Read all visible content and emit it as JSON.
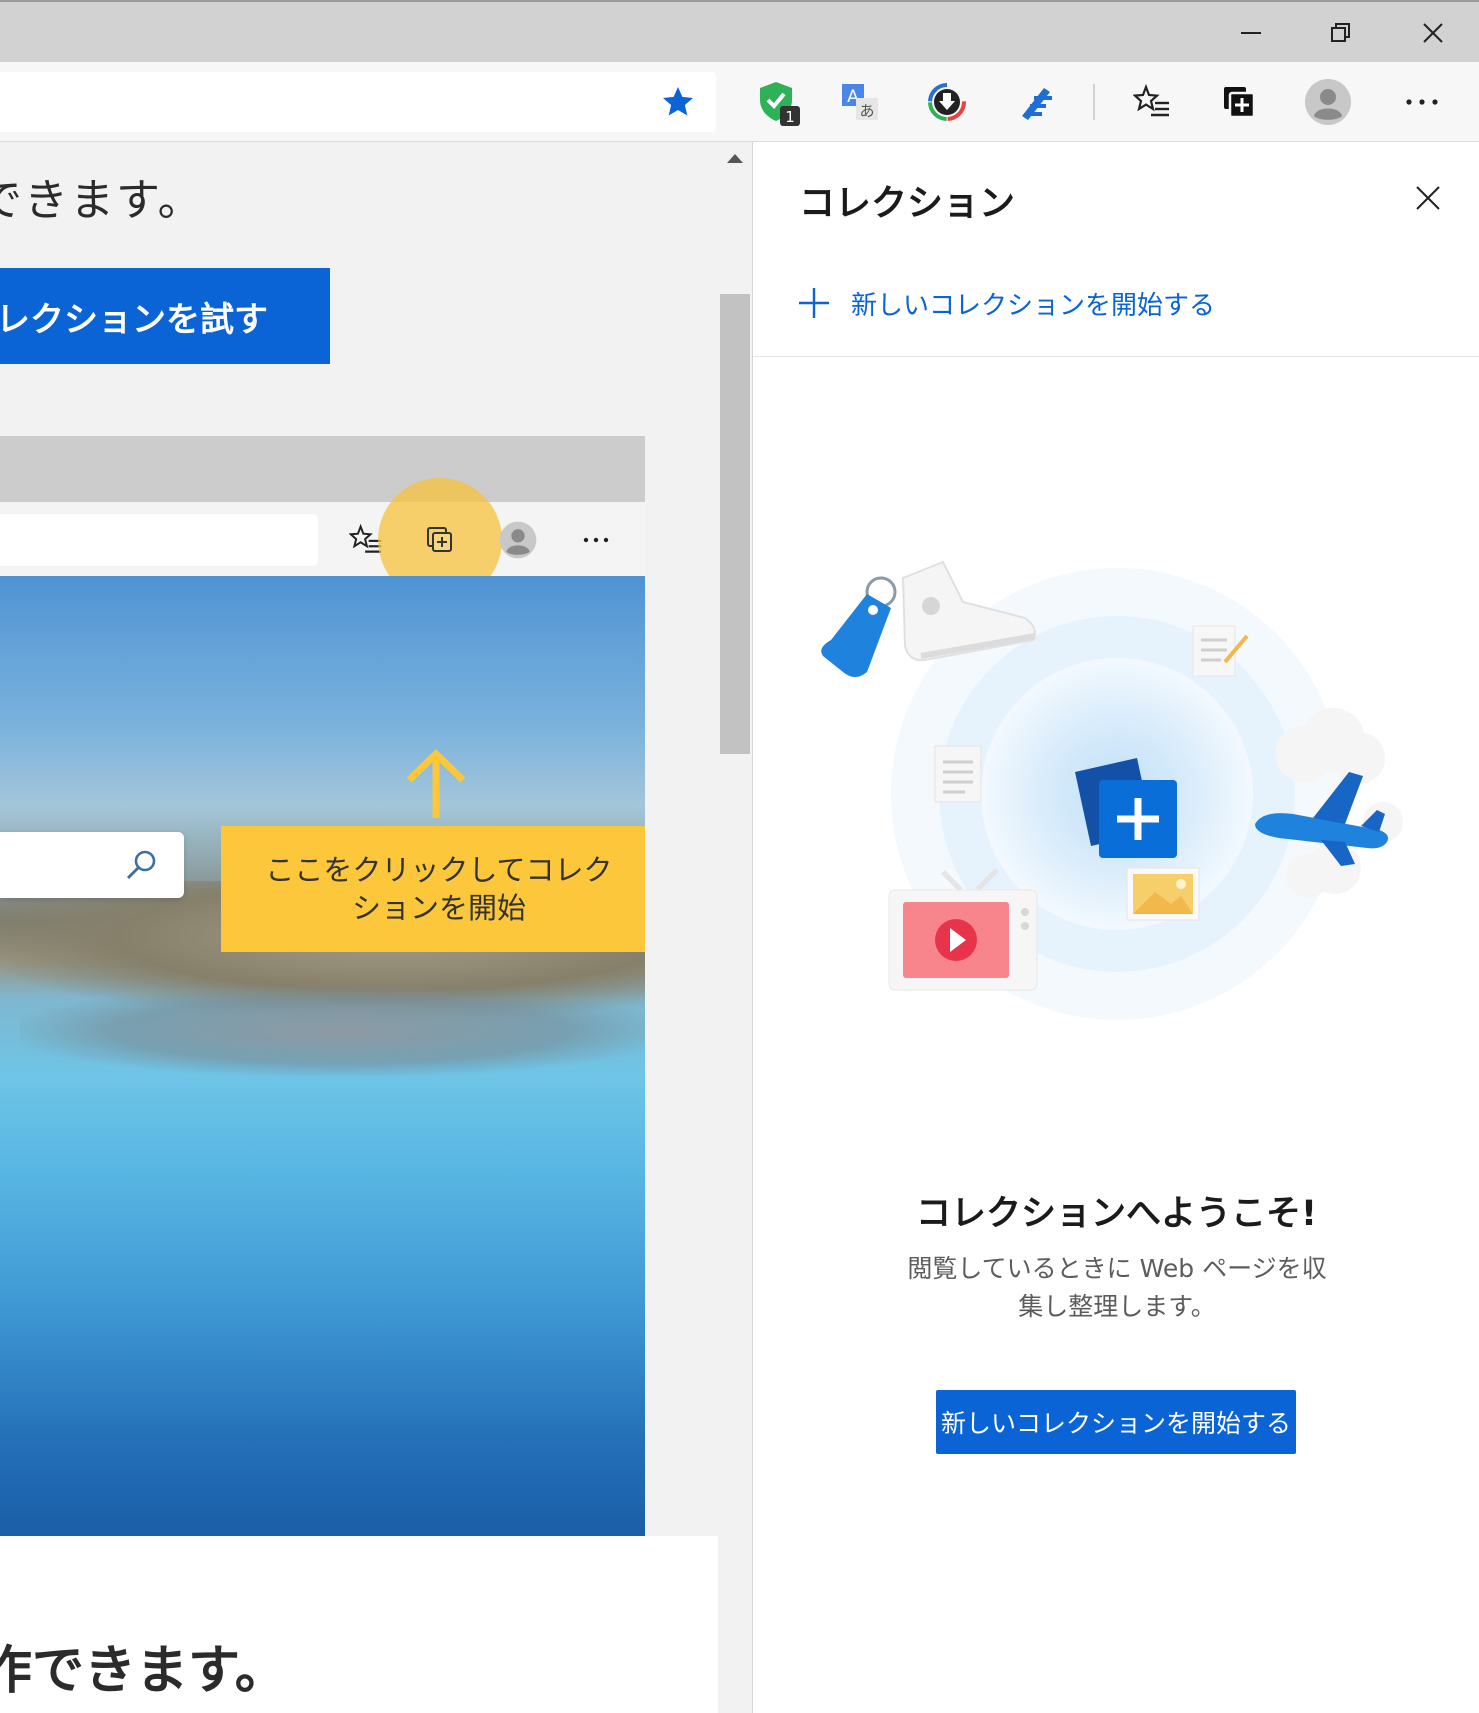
{
  "page": {
    "heading_top": "できます。",
    "try_button": "レクションを試す",
    "callout": "ここをクリックしてコレクションを開始",
    "heading_bottom": "作できます。"
  },
  "panel": {
    "title": "コレクション",
    "new_collection_link": "新しいコレクションを開始する",
    "welcome_title": "コレクションへようこそ!",
    "welcome_desc": "閲覧しているときに Web ページを収集し整理します。",
    "start_button": "新しいコレクションを開始する"
  },
  "toolbar": {
    "extension_badge": "1",
    "icons": [
      "favorite-star-icon",
      "shield-extension-icon",
      "translate-icon",
      "download-extension-icon",
      "pen-extension-icon",
      "favorites-icon",
      "collections-icon",
      "profile-icon",
      "more-icon"
    ]
  },
  "colors": {
    "accent": "#0a64d6",
    "callout": "#fcc73a",
    "titlebar": "#d2d2d2"
  }
}
